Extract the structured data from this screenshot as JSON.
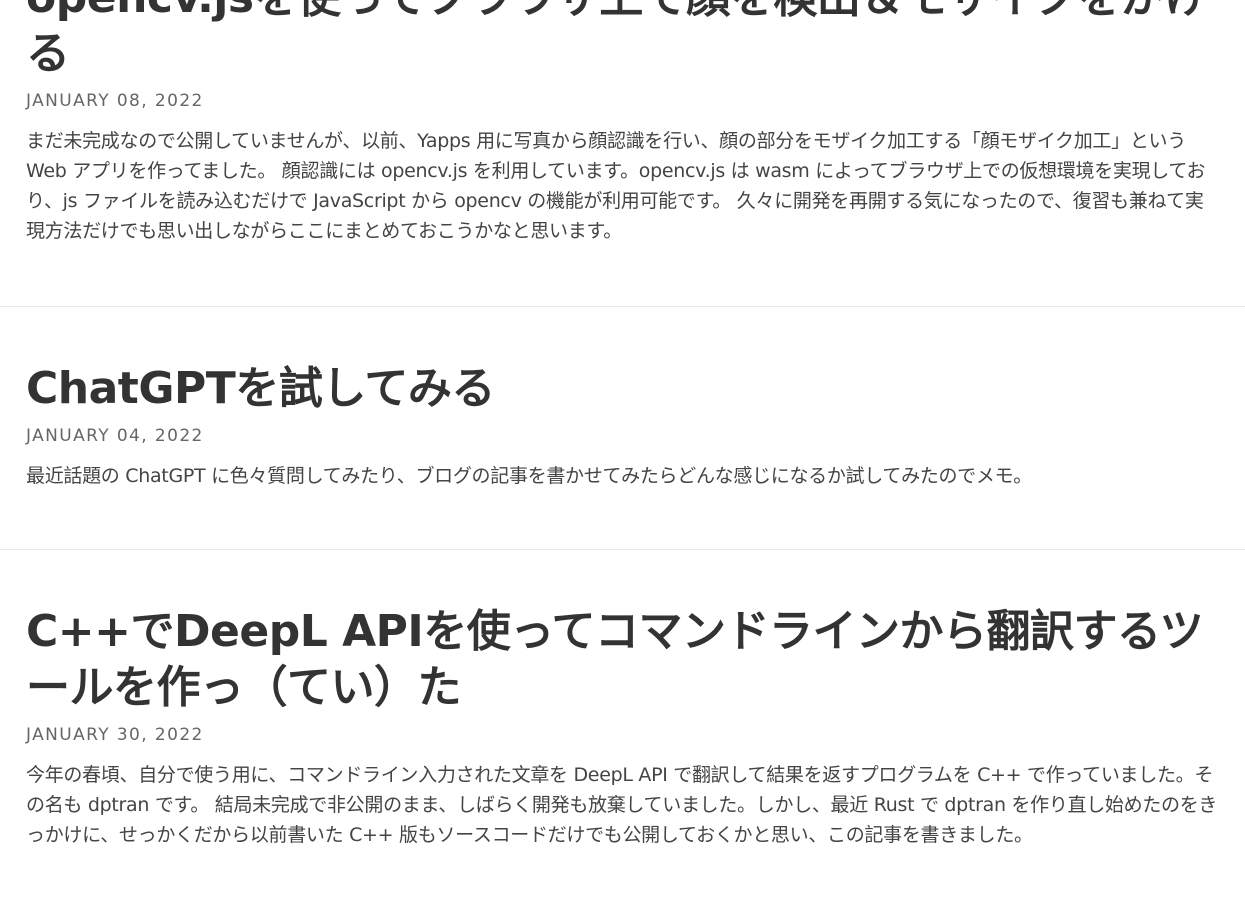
{
  "posts": [
    {
      "title": "opencv.jsを使ってブラウザ上で顔を検出＆モザイクをかける",
      "date": "JANUARY 08, 2022",
      "excerpt": "まだ未完成なので公開していませんが、以前、Yapps 用に写真から顔認識を行い、顔の部分をモザイク加工する「顔モザイク加工」という Web アプリを作ってました。 顔認識には opencv.js を利用しています。opencv.js は wasm によってブラウザ上での仮想環境を実現しており、js ファイルを読み込むだけで JavaScript から opencv の機能が利用可能です。 久々に開発を再開する気になったので、復習も兼ねて実現方法だけでも思い出しながらここにまとめておこうかなと思います。"
    },
    {
      "title": "ChatGPTを試してみる",
      "date": "JANUARY 04, 2022",
      "excerpt": "最近話題の ChatGPT に色々質問してみたり、ブログの記事を書かせてみたらどんな感じになるか試してみたのでメモ。"
    },
    {
      "title": "C++でDeepL APIを使ってコマンドラインから翻訳するツールを作っ（てい）た",
      "date": "JANUARY 30, 2022",
      "excerpt": "今年の春頃、自分で使う用に、コマンドライン入力された文章を DeepL API で翻訳して結果を返すプログラムを C++ で作っていました。その名も dptran です。 結局未完成で非公開のまま、しばらく開発も放棄していました。しかし、最近 Rust で dptran を作り直し始めたのをきっかけに、せっかくだから以前書いた C++ 版もソースコードだけでも公開しておくかと思い、この記事を書きました。"
    }
  ]
}
